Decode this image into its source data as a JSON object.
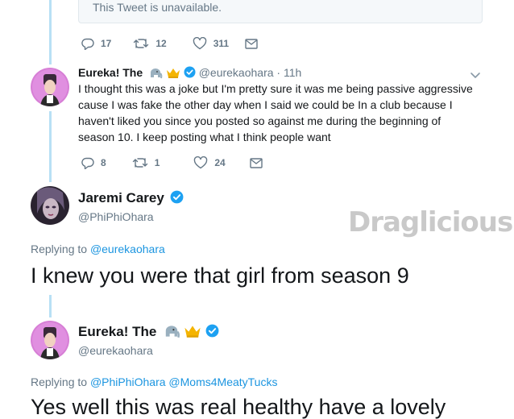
{
  "unavailable": {
    "text": "This Tweet is unavailable."
  },
  "tweet1_actions": {
    "replies": "17",
    "retweets": "12",
    "likes": "311"
  },
  "tweet2": {
    "name": "Eureka! The",
    "handle": "@eurekaohara",
    "time": "· 11h",
    "text_lines": [
      "I thought this was a joke but I'm pretty sure it was me being passive aggressive",
      "cause I was fake the other day when I said we could be In a club because I",
      "haven't liked you since you posted so against me during the beginning of",
      "season 10. I keep posting what I think people want"
    ],
    "replies": "8",
    "retweets": "1",
    "likes": "24"
  },
  "tweet3": {
    "name": "Jaremi Carey",
    "handle": "@PhiPhiOhara",
    "replying_prefix": "Replying to ",
    "replying_to": "@eurekaohara",
    "text": "I knew you were that girl from season 9"
  },
  "tweet4": {
    "name": "Eureka! The",
    "handle": "@eurekaohara",
    "replying_prefix": "Replying to ",
    "replying_to_1": "@PhiPhiOhara",
    "replying_to_2": "@Moms4MeatyTucks",
    "text": "Yes well this was real healthy have a lovely"
  },
  "watermark": {
    "part1": "Drag",
    "part2": "licious"
  },
  "colors": {
    "accent": "#1da1f2",
    "link": "#1b95e0",
    "muted": "#657786",
    "thread": "#b8e0f5"
  }
}
